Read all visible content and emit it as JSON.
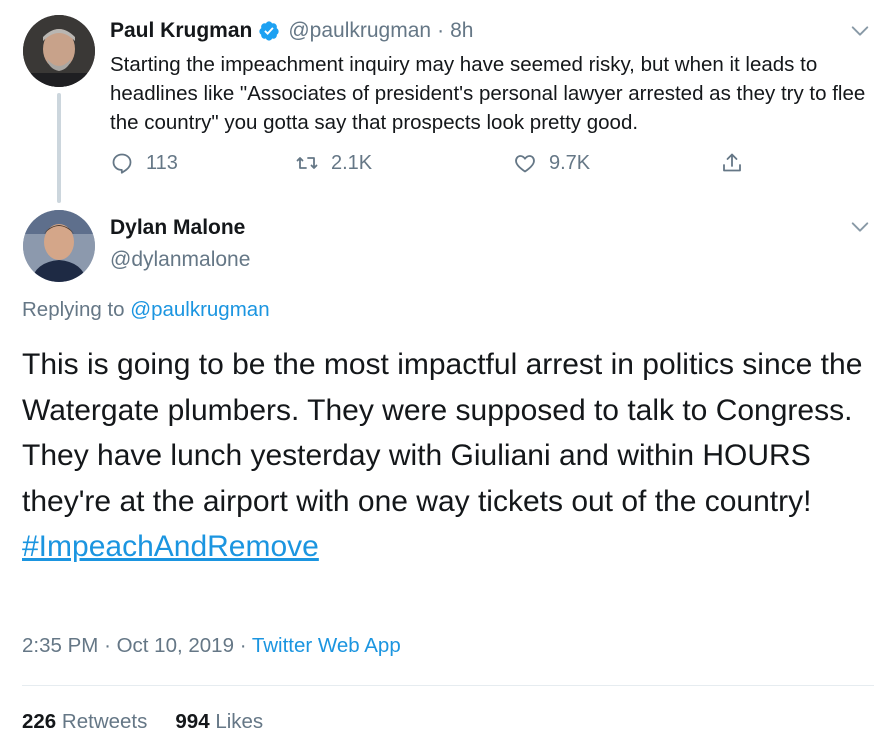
{
  "parent_tweet": {
    "name": "Paul Krugman",
    "handle": "@paulkrugman",
    "dot": "·",
    "time": "8h",
    "text": "Starting the impeachment inquiry may have seemed risky, but when it leads to headlines like \"Associates of president's personal lawyer arrested as they try to flee the country\" you gotta say that prospects look pretty good.",
    "replies": "113",
    "retweets": "2.1K",
    "likes": "9.7K",
    "icons": [
      "verified-badge-icon",
      "chevron-down-icon",
      "reply-icon",
      "retweet-icon",
      "like-icon",
      "share-icon"
    ]
  },
  "main_tweet": {
    "name": "Dylan Malone",
    "handle": "@dylanmalone",
    "replying_prefix": "Replying to ",
    "replying_to": "@paulkrugman",
    "text": "This is going to be the most impactful arrest in politics since the Watergate plumbers. They were supposed to talk to Congress. They have lunch yesterday with Giuliani and within HOURS they're at the airport with one way tickets out of the country!",
    "hashtag": "#ImpeachAndRemove",
    "time": "2:35 PM",
    "dot1": "·",
    "date": "Oct 10, 2019",
    "dot2": "·",
    "source": "Twitter Web App",
    "retweet_count": "226",
    "retweet_label": "Retweets",
    "like_count": "994",
    "like_label": "Likes"
  },
  "colors": {
    "link_blue": "#1b95e0",
    "secondary_gray": "#657786",
    "primary_text": "#14171a",
    "thread_line": "#ccd6dd",
    "divider": "#e6ecf0"
  }
}
